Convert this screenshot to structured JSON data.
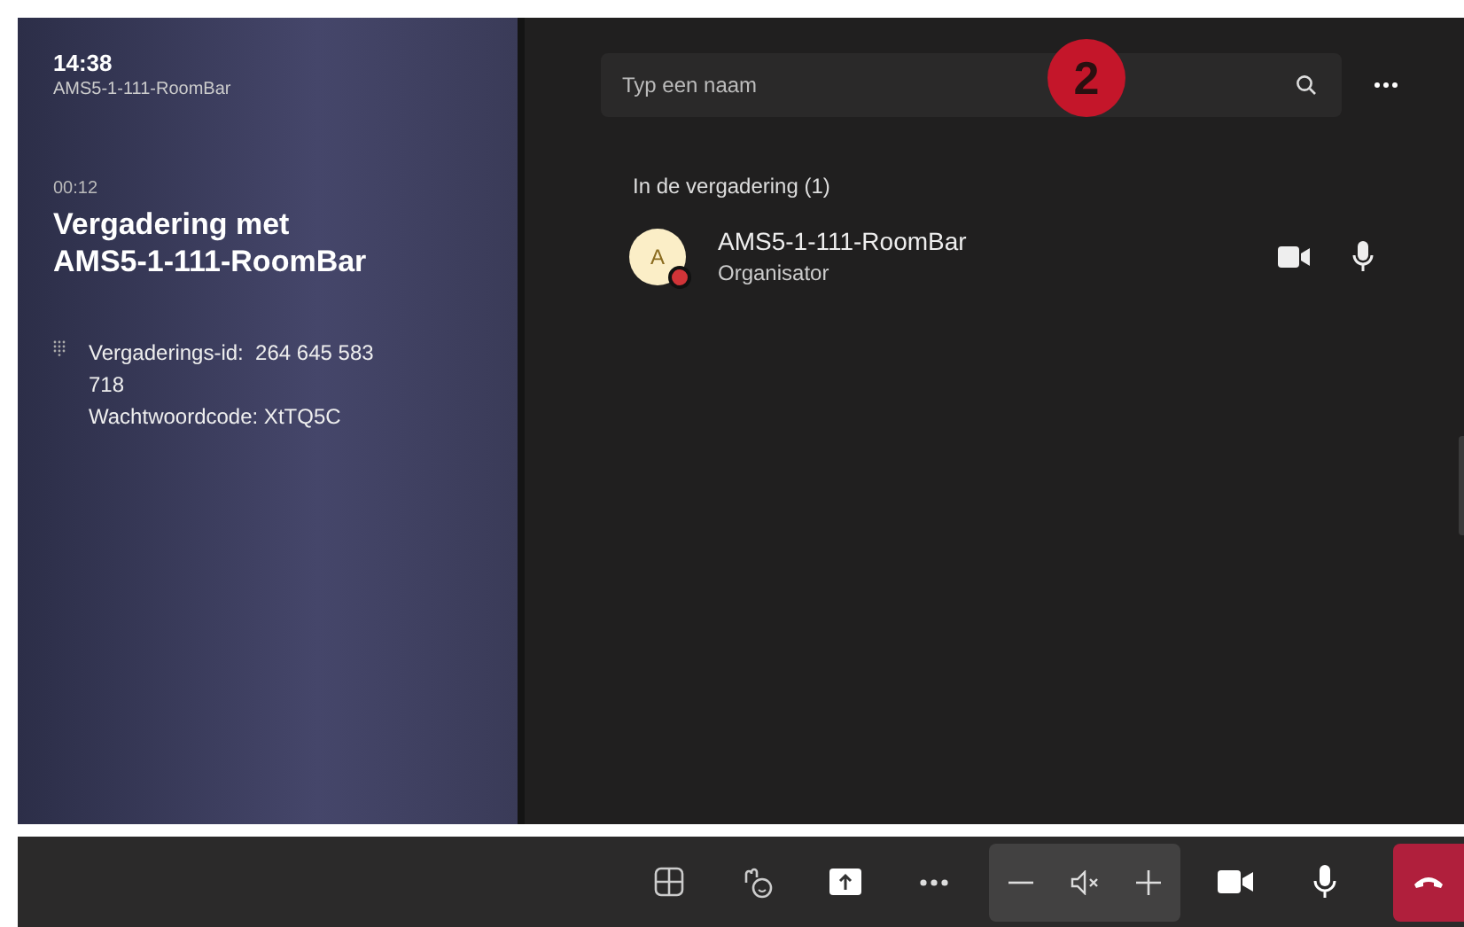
{
  "room": {
    "time": "14:38",
    "name": "AMS5-1-111-RoomBar"
  },
  "meeting": {
    "duration": "00:12",
    "title": "Vergadering met AMS5-1-111-RoomBar",
    "id_label": "Vergaderings-id:",
    "id_value": "264 645 583 718",
    "password": "Wachtwoordcode: XtTQ5C"
  },
  "search": {
    "placeholder": "Typ een naam"
  },
  "badge": "2",
  "section": "In de vergadering (1)",
  "participants": [
    {
      "initial": "A",
      "name": "AMS5-1-111-RoomBar",
      "role": "Organisator",
      "color": "#d13438"
    }
  ],
  "volume_control": {
    "muted": true
  }
}
